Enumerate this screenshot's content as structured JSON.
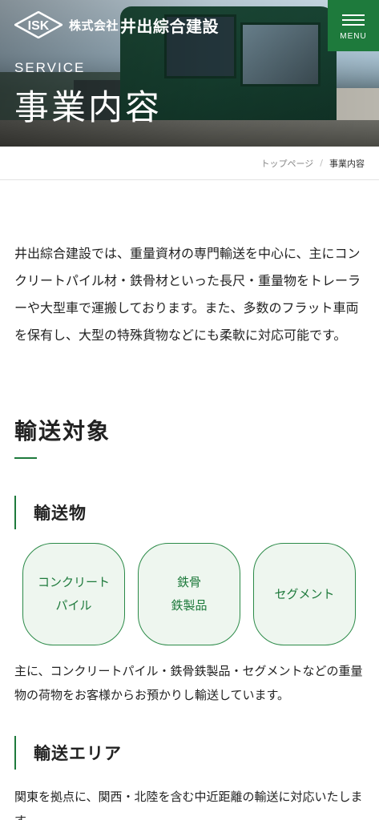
{
  "header": {
    "logo_abbr": "ISK",
    "company_prefix": "株式会社",
    "company_name": "井出綜合建設",
    "menu_label": "MENU"
  },
  "hero": {
    "eyebrow": "SERVICE",
    "title": "事業内容"
  },
  "breadcrumb": {
    "home": "トップページ",
    "separator": "/",
    "current": "事業内容"
  },
  "intro": {
    "text": "井出綜合建設では、重量資材の専門輸送を中心に、主にコンクリートパイル材・鉄骨材といった長尺・重量物をトレーラーや大型車で運搬しております。また、多数のフラット車両を保有し、大型の特殊貨物などにも柔軟に対応可能です。"
  },
  "section": {
    "title": "輸送対象"
  },
  "cargo": {
    "heading": "輸送物",
    "items": [
      {
        "label": "コンクリート\nパイル"
      },
      {
        "label": "鉄骨\n鉄製品"
      },
      {
        "label": "セグメント"
      }
    ],
    "description": "主に、コンクリートパイル・鉄骨鉄製品・セグメントなどの重量物の荷物をお客様からお預かりし輸送しています。"
  },
  "area": {
    "heading": "輸送エリア",
    "description": "関東を拠点に、関西・北陸を含む中近距離の輸送に対応いたします。"
  },
  "colors": {
    "accent": "#1e7a3c",
    "cargo_bg": "#eef6ef"
  }
}
